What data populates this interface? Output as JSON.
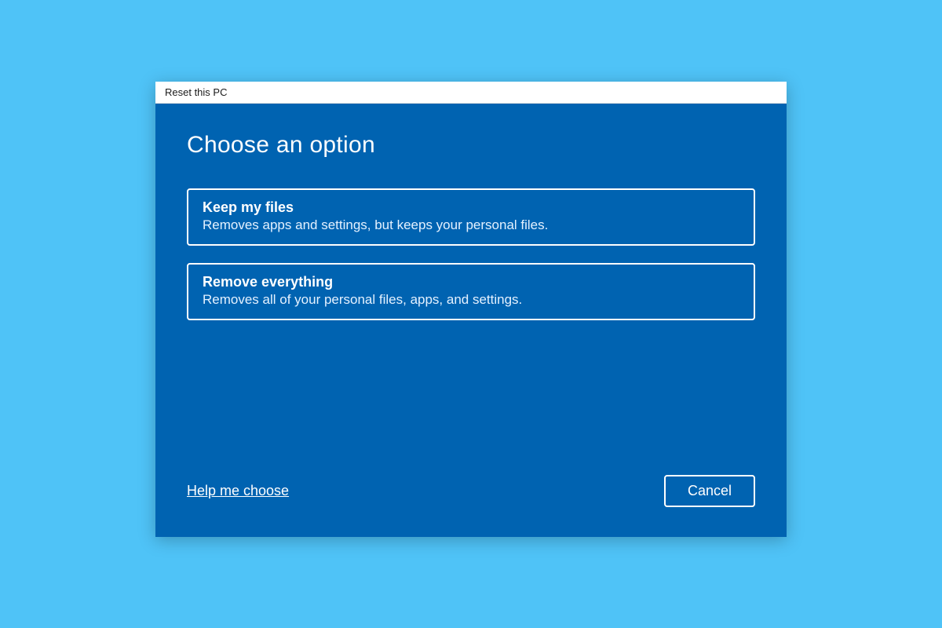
{
  "window": {
    "title": "Reset this PC"
  },
  "dialog": {
    "heading": "Choose an option",
    "options": [
      {
        "title": "Keep my files",
        "description": "Removes apps and settings, but keeps your personal files."
      },
      {
        "title": "Remove everything",
        "description": "Removes all of your personal files, apps, and settings."
      }
    ],
    "help_link": "Help me choose",
    "cancel_label": "Cancel"
  }
}
